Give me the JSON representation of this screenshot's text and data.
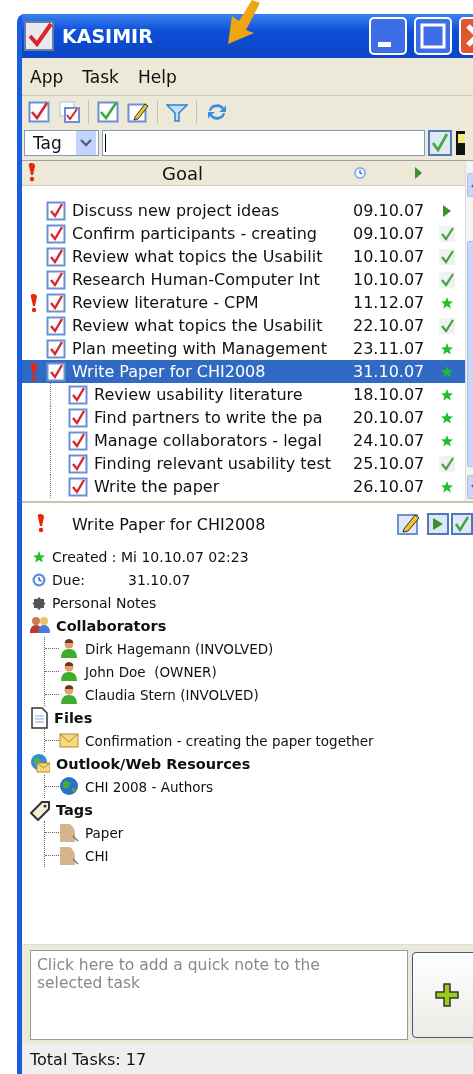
{
  "window": {
    "title": "KASIMIR"
  },
  "menu": [
    {
      "label": "App"
    },
    {
      "label": "Task"
    },
    {
      "label": "Help"
    }
  ],
  "filter": {
    "field": "Tag"
  },
  "table": {
    "columns": [
      {
        "label": "Goal"
      }
    ],
    "rows": [
      {
        "title": "Discuss new project ideas",
        "due": "09.10.07",
        "important": false,
        "checked": true,
        "kind": "play",
        "selected": false
      },
      {
        "title": "Confirm participants - creating",
        "due": "09.10.07",
        "important": false,
        "checked": true,
        "kind": "done",
        "selected": false
      },
      {
        "title": "Review what topics the Usabilit",
        "due": "10.10.07",
        "important": false,
        "checked": true,
        "kind": "done",
        "selected": false
      },
      {
        "title": "Research Human-Computer Int",
        "due": "10.10.07",
        "important": false,
        "checked": true,
        "kind": "done",
        "selected": false
      },
      {
        "title": "Review literature - CPM",
        "due": "11.12.07",
        "important": true,
        "checked": true,
        "kind": "new",
        "selected": false
      },
      {
        "title": "Review what topics the Usabilit",
        "due": "22.10.07",
        "important": false,
        "checked": true,
        "kind": "done",
        "selected": false
      },
      {
        "title": "Plan meeting with Management",
        "due": "23.11.07",
        "important": false,
        "checked": true,
        "kind": "new",
        "selected": false
      },
      {
        "title": "Write Paper for CHI2008",
        "due": "31.10.07",
        "important": true,
        "checked": true,
        "kind": "new",
        "selected": true,
        "children": [
          {
            "title": "Review usability literature",
            "due": "18.10.07",
            "important": false,
            "checked": true,
            "kind": "new",
            "selected": false
          },
          {
            "title": "Find partners to write the pa",
            "due": "20.10.07",
            "important": false,
            "checked": true,
            "kind": "new",
            "selected": false
          },
          {
            "title": "Manage collaborators - legal",
            "due": "24.10.07",
            "important": false,
            "checked": true,
            "kind": "new",
            "selected": false
          },
          {
            "title": "Finding relevant usability test",
            "due": "25.10.07",
            "important": false,
            "checked": true,
            "kind": "done",
            "selected": false
          },
          {
            "title": "Write the paper",
            "due": "26.10.07",
            "important": false,
            "checked": true,
            "kind": "new",
            "selected": false
          }
        ]
      }
    ]
  },
  "detail": {
    "title": "Write Paper for CHI2008",
    "important": true,
    "facts": [
      {
        "kind": "created",
        "text": "Created : Mi 10.10.07 02:23"
      },
      {
        "kind": "due",
        "label": "Due:",
        "text": "31.10.07"
      },
      {
        "kind": "notes",
        "text": "Personal Notes"
      }
    ],
    "sections": [
      {
        "kind": "collaborators",
        "heading": "Collaborators",
        "items": [
          "Dirk Hagemann (INVOLVED)",
          "John Doe  (OWNER)",
          "Claudia Stern (INVOLVED)"
        ]
      },
      {
        "kind": "files",
        "heading": "Files",
        "items": [
          "Confirmation - creating the paper together"
        ]
      },
      {
        "kind": "resources",
        "heading": "Outlook/Web Resources",
        "items": [
          "CHI 2008 - Authors"
        ]
      },
      {
        "kind": "tags",
        "heading": "Tags",
        "items": [
          "Paper",
          "CHI"
        ]
      }
    ]
  },
  "quick_note": {
    "placeholder": "Click here to add a quick note to the selected task"
  },
  "status_bar": {
    "text": "Total Tasks: 17"
  }
}
